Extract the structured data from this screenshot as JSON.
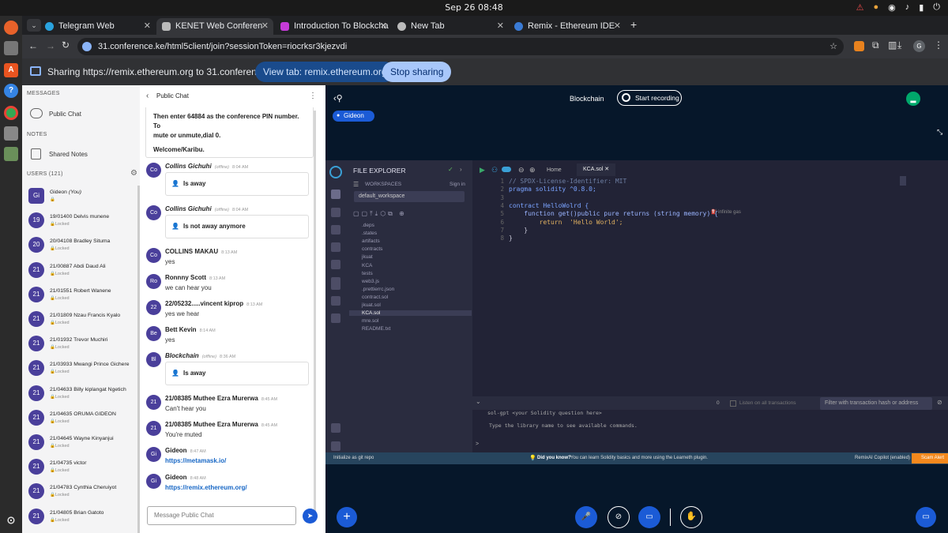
{
  "system": {
    "clock": "Sep 26  08:48"
  },
  "browser": {
    "tabs": [
      {
        "label": "Telegram Web",
        "active": false
      },
      {
        "label": "KENET Web Conferen",
        "active": true
      },
      {
        "label": "Introduction To Blockcha",
        "active": false
      },
      {
        "label": "New Tab",
        "active": false
      },
      {
        "label": "Remix - Ethereum IDE",
        "active": false
      }
    ],
    "url": "31.conference.ke/html5client/join?sessionToken=riocrksr3kjezvdi",
    "sharing_text": "Sharing https://remix.ethereum.org to 31.conference.ke",
    "view_tab_label": "View tab: remix.ethereum.org",
    "stop_sharing_label": "Stop sharing",
    "profile_initial": "G"
  },
  "sidebar": {
    "messages_header": "MESSAGES",
    "public_chat": "Public Chat",
    "notes_header": "NOTES",
    "shared_notes": "Shared Notes",
    "users_header": "USERS (121)",
    "users": [
      {
        "initials": "Gi",
        "name": "Gideon",
        "suffix": "(You)",
        "locked": ""
      },
      {
        "initials": "19",
        "name": "19/01400 Delvis munene",
        "suffix": "",
        "locked": "Locked"
      },
      {
        "initials": "20",
        "name": "20/04108 Bradley Situma",
        "suffix": "",
        "locked": "Locked"
      },
      {
        "initials": "21",
        "name": "21/00887 Abdi Daud Ali",
        "suffix": "",
        "locked": "Locked"
      },
      {
        "initials": "21",
        "name": "21/01551 Robert Wanene",
        "suffix": "",
        "locked": "Locked"
      },
      {
        "initials": "21",
        "name": "21/01809 Nzau Francis Kyalo",
        "suffix": "",
        "locked": "Locked"
      },
      {
        "initials": "21",
        "name": "21/01932 Trevor Muchiri",
        "suffix": "",
        "locked": "Locked"
      },
      {
        "initials": "21",
        "name": "21/03933 Mwangi Prince Gichere",
        "suffix": "",
        "locked": "Locked"
      },
      {
        "initials": "21",
        "name": "21/04633 Billy kiplangat Ngetich",
        "suffix": "",
        "locked": "Locked"
      },
      {
        "initials": "21",
        "name": "21/04635 ORUMA GIDEON",
        "suffix": "",
        "locked": "Locked"
      },
      {
        "initials": "21",
        "name": "21/04645 Wayne Kinyanjui",
        "suffix": "",
        "locked": "Locked"
      },
      {
        "initials": "21",
        "name": "21/04735 victor",
        "suffix": "",
        "locked": "Locked"
      },
      {
        "initials": "21",
        "name": "21/04783 Cynthia Cheruiyot",
        "suffix": "",
        "locked": "Locked"
      },
      {
        "initials": "21",
        "name": "21/04805 Brian Gatoto",
        "suffix": "",
        "locked": "Locked"
      }
    ]
  },
  "chat": {
    "title": "Public Chat",
    "welcome_line1": "Then enter 64884 as the conference PIN number. To",
    "welcome_line2": "mute or unmute,dial 0.",
    "welcome_line3": "Welcome/Karibu.",
    "offline_tag": "(offline)",
    "messages": [
      {
        "initials": "Co",
        "sender": "Collins Gichuhi",
        "offline": true,
        "time": "8:04 AM",
        "text": "Is away",
        "boxed": true,
        "link": false
      },
      {
        "initials": "Co",
        "sender": "Collins Gichuhi",
        "offline": true,
        "time": "8:04 AM",
        "text": "Is not away anymore",
        "boxed": true,
        "link": false
      },
      {
        "initials": "Co",
        "sender": "COLLINS MAKAU",
        "offline": false,
        "time": "8:13 AM",
        "text": "yes",
        "boxed": false,
        "link": false
      },
      {
        "initials": "Ro",
        "sender": "Ronnny Scott",
        "offline": false,
        "time": "8:13 AM",
        "text": "we can hear you",
        "boxed": false,
        "link": false
      },
      {
        "initials": "22",
        "sender": "22/05232.....vincent kiprop",
        "offline": false,
        "time": "8:13 AM",
        "text": "yes we hear",
        "boxed": false,
        "link": false
      },
      {
        "initials": "Be",
        "sender": "Bett Kevin",
        "offline": false,
        "time": "8:14 AM",
        "text": "yes",
        "boxed": false,
        "link": false
      },
      {
        "initials": "Bl",
        "sender": "Blockchain",
        "offline": true,
        "time": "8:36 AM",
        "text": "Is away",
        "boxed": true,
        "link": false
      },
      {
        "initials": "21",
        "sender": "21/08385 Muthee Ezra Murerwa",
        "offline": false,
        "time": "8:45 AM",
        "text": "Can't hear you",
        "boxed": false,
        "link": false
      },
      {
        "initials": "21",
        "sender": "21/08385 Muthee Ezra Murerwa",
        "offline": false,
        "time": "8:45 AM",
        "text": "You're muted",
        "boxed": false,
        "link": false
      },
      {
        "initials": "Gi",
        "sender": "Gideon",
        "offline": false,
        "time": "8:47 AM",
        "text": "https://metamask.io/",
        "boxed": false,
        "link": true
      },
      {
        "initials": "Gi",
        "sender": "Gideon",
        "offline": false,
        "time": "8:48 AM",
        "text": "https://remix.ethereum.org/",
        "boxed": false,
        "link": true
      }
    ],
    "input_placeholder": "Message Public Chat"
  },
  "meeting": {
    "presentation_title": "Blockchain",
    "record_label": "Start recording",
    "presenter_name": "Gideon"
  },
  "remix": {
    "explorer_title": "FILE EXPLORER",
    "workspaces_label": "WORKSPACES",
    "sign_in": "Sign in",
    "workspace_name": "default_workspace",
    "files": [
      ".deps",
      ".states",
      "artifacts",
      "contracts",
      "jkuat",
      "KCA",
      "tests",
      "web3.js",
      ".prettierrc.json",
      "contract.sol",
      "jkuat.sol",
      "KCA.sol",
      "mre.sol",
      "README.txt"
    ],
    "selected_file": "KCA.sol",
    "home_tab": "Home",
    "file_tab": "KCA.sol",
    "code_lines": [
      "// SPDX-License-Identifier: MIT",
      "pragma solidity ^0.8.0;",
      "",
      "contract HelloWolrd {",
      "    function get()public pure returns (string memory) {",
      "        return  'Hello World';",
      "    }",
      "}"
    ],
    "gas_hint": "infinite gas",
    "terminal_count": "0",
    "listen_label": "Listen on all transactions",
    "filter_placeholder": "Filter with transaction hash or address",
    "terminal_line1": "sol-gpt <your Solidity question here>",
    "terminal_line2": "Type the library name to see available commands.",
    "terminal_prompt": ">",
    "status_left": "Initialize as git repo",
    "status_know": "Did you know?",
    "status_tip": "You can learn Solidity basics and more using the Learneth plugin.",
    "status_copilot": "RemixAI Copilot (enabled)",
    "status_scam": "Scam Alert"
  },
  "colors": {
    "accent": "#8ab4f8",
    "bbb_dark": "#06172a",
    "bbb_blue": "#1b5bd6",
    "remix_bg": "#222336",
    "status_orange": "#f5891d"
  }
}
